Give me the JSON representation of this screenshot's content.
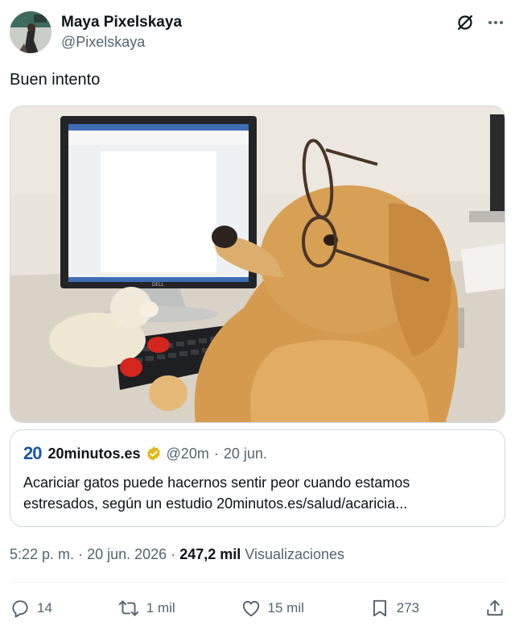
{
  "author": {
    "display_name": "Maya Pixelskaya",
    "handle": "@Pixelskaya"
  },
  "tweet": {
    "text": "Buen intento"
  },
  "quote": {
    "logo": "20",
    "name": "20minutos.es",
    "handle": "@20m",
    "separator": "·",
    "date": "20 jun.",
    "text_line1": "Acariciar gatos puede hacernos sentir peor cuando estamos",
    "text_line2": "estresados, según un estudio 20minutos.es/salud/acaricia..."
  },
  "meta": {
    "time": "5:22 p. m.",
    "separator": "·",
    "date": "20 jun. 2026",
    "separator2": "·",
    "views_count": "247,2 mil",
    "views_label": "Visualizaciones"
  },
  "actions": {
    "replies": "14",
    "reposts": "1 mil",
    "likes": "15 mil",
    "bookmarks": "273"
  },
  "colors": {
    "text_primary": "#0f1419",
    "text_secondary": "#536471",
    "border": "#cfd9de",
    "verified_gold": "#e2b719",
    "quote_logo_blue": "#1a55a8"
  },
  "icons": [
    "grok-icon",
    "more-icon",
    "reply-icon",
    "repost-icon",
    "like-icon",
    "bookmark-icon",
    "share-icon",
    "verified-badge-icon"
  ]
}
